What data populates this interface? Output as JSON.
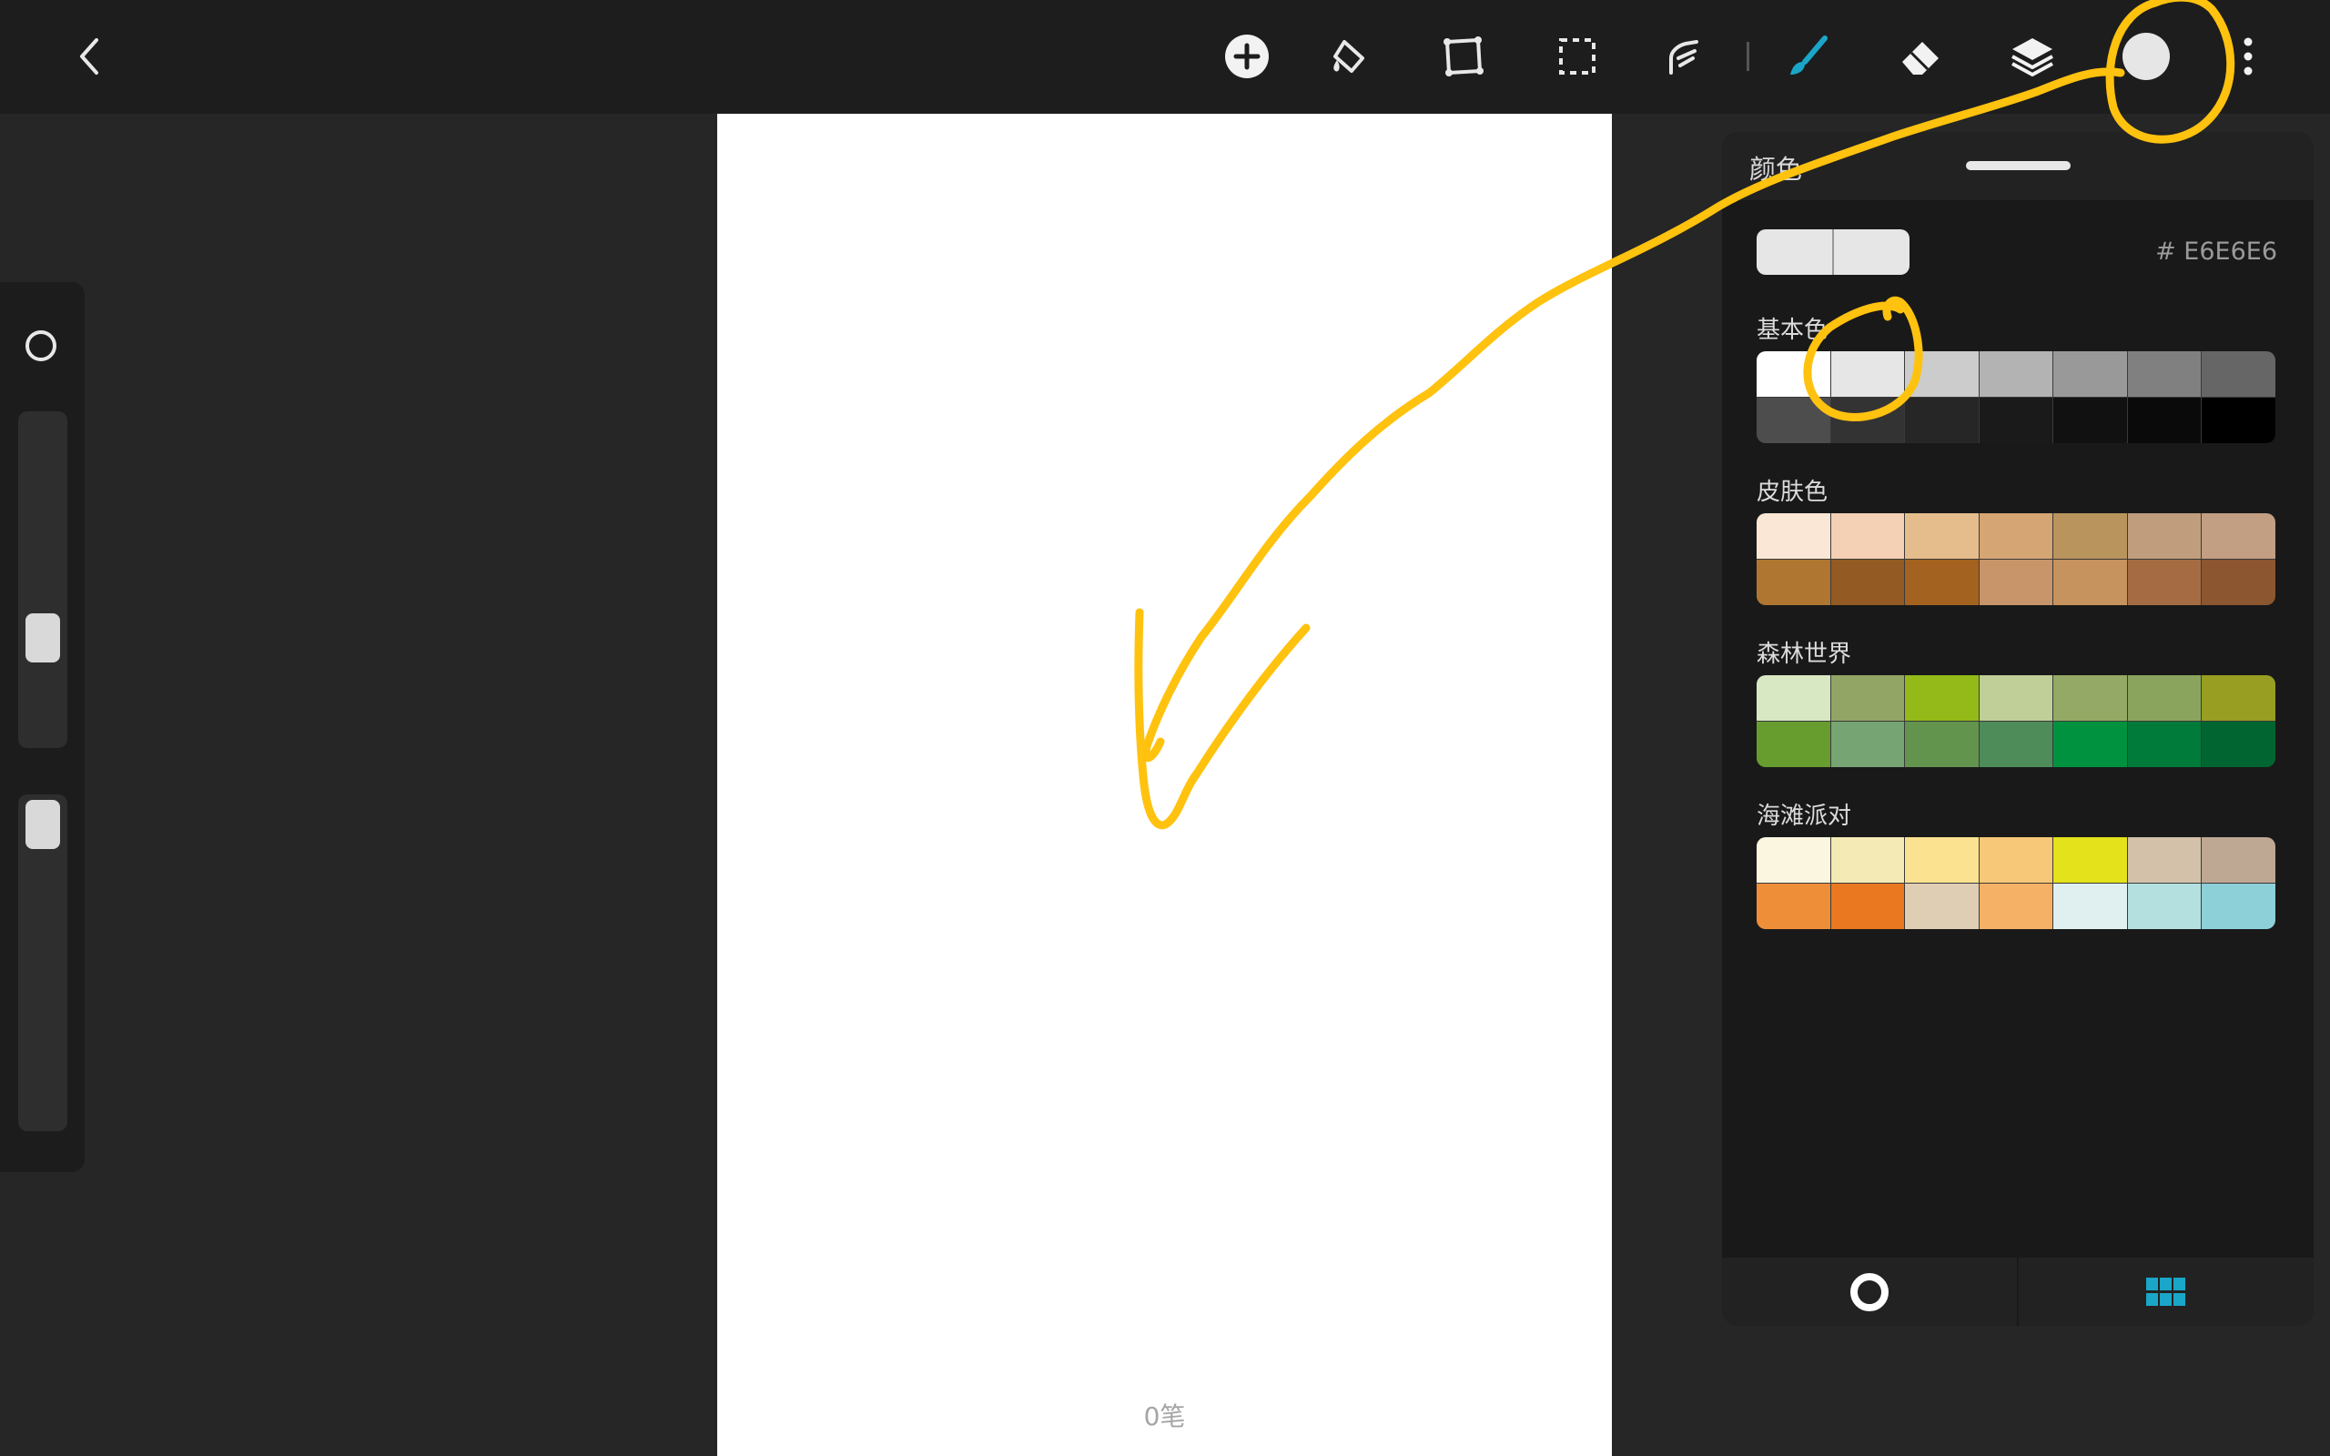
{
  "canvas": {
    "stroke_count": "0笔"
  },
  "toolbar": {
    "back": "chevron-left-icon",
    "items": [
      "add-icon",
      "fill-bucket-icon",
      "transform-icon",
      "selection-icon",
      "smudge-icon",
      "brush-icon",
      "eraser-icon",
      "layers-icon",
      "color-icon",
      "more-icon"
    ],
    "active_tool": "brush-icon",
    "active_color": "#E6E6E6",
    "accent_color": "#1aa6c8"
  },
  "color_panel": {
    "title": "颜色",
    "current_hex": "# E6E6E6",
    "current_color": "#E6E6E6",
    "palettes": [
      {
        "name": "基本色",
        "colors": [
          "#ffffff",
          "#e6e6e6",
          "#cccccc",
          "#b3b3b3",
          "#999999",
          "#808080",
          "#666666",
          "#4d4d4d",
          "#333333",
          "#262626",
          "#1a1a1a",
          "#111111",
          "#0a0a0a",
          "#000000"
        ]
      },
      {
        "name": "皮肤色",
        "colors": [
          "#fae7d5",
          "#f4d0b5",
          "#e5bd8c",
          "#d6a574",
          "#b9945c",
          "#bf9d7d",
          "#c29e82",
          "#ae7631",
          "#935a23",
          "#a3621f",
          "#c8956a",
          "#c6925e",
          "#a56c43",
          "#8c5630"
        ]
      },
      {
        "name": "森林世界",
        "colors": [
          "#d8e8c3",
          "#93a565",
          "#93ba18",
          "#c0cf97",
          "#94a965",
          "#8ba45d",
          "#979e22",
          "#679c2f",
          "#76a473",
          "#63944e",
          "#4e8c5a",
          "#00923f",
          "#007b39",
          "#006530"
        ]
      },
      {
        "name": "海滩派对",
        "colors": [
          "#fbf6e0",
          "#f3eab5",
          "#fae290",
          "#f7c878",
          "#e4e21a",
          "#d3c1aa",
          "#bea793",
          "#ef8e38",
          "#e97820",
          "#dfcdb4",
          "#f5b166",
          "#e0f0f0",
          "#b5e0e0",
          "#8dd0d8"
        ]
      }
    ],
    "footer_tabs": [
      "color-wheel-icon",
      "palette-grid-icon"
    ],
    "active_tab": "palette-grid-icon"
  },
  "annotation_color": "#FFC20E"
}
